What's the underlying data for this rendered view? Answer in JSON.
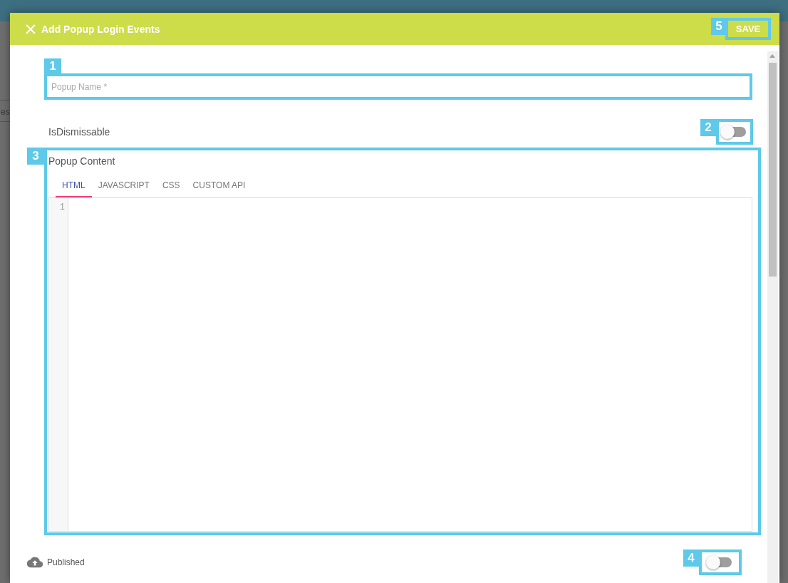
{
  "background": {
    "text": "es"
  },
  "dialog": {
    "title": "Add Popup Login Events",
    "save_button": {
      "label": "SAVE",
      "callout": "5"
    }
  },
  "name_field": {
    "placeholder": "Popup Name *",
    "callout": "1"
  },
  "dismissable": {
    "label": "IsDismissable",
    "on": false,
    "callout": "2"
  },
  "content": {
    "label": "Popup Content",
    "callout": "3",
    "tabs": [
      {
        "label": "HTML",
        "selected": true
      },
      {
        "label": "JAVASCRIPT",
        "selected": false
      },
      {
        "label": "CSS",
        "selected": false
      },
      {
        "label": "CUSTOM API",
        "selected": false
      }
    ],
    "editor": {
      "line_numbers": [
        "1"
      ]
    }
  },
  "published": {
    "label": "Published",
    "on": false,
    "callout": "4"
  }
}
